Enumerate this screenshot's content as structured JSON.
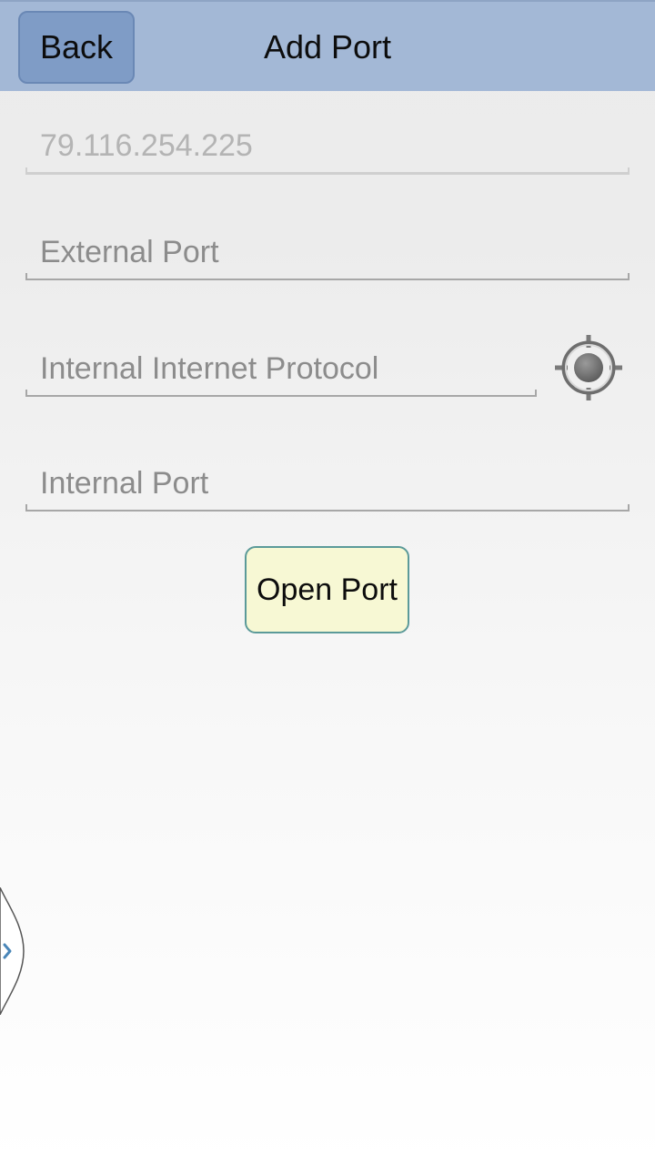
{
  "header": {
    "back_label": "Back",
    "title": "Add Port"
  },
  "form": {
    "external_ip_value": "79.116.254.225",
    "external_port_placeholder": "External Port",
    "internal_ip_placeholder": "Internal Internet Protocol",
    "internal_port_placeholder": "Internal Port"
  },
  "actions": {
    "open_port_label": "Open Port"
  },
  "icons": {
    "locate": "crosshair-target-icon",
    "side_tab": "chevron-right-icon"
  },
  "colors": {
    "header_bar": "#a3b8d6",
    "back_button": "#7f9cc6",
    "open_button_fill": "#f7f8d4",
    "open_button_border": "#5b9a99"
  }
}
